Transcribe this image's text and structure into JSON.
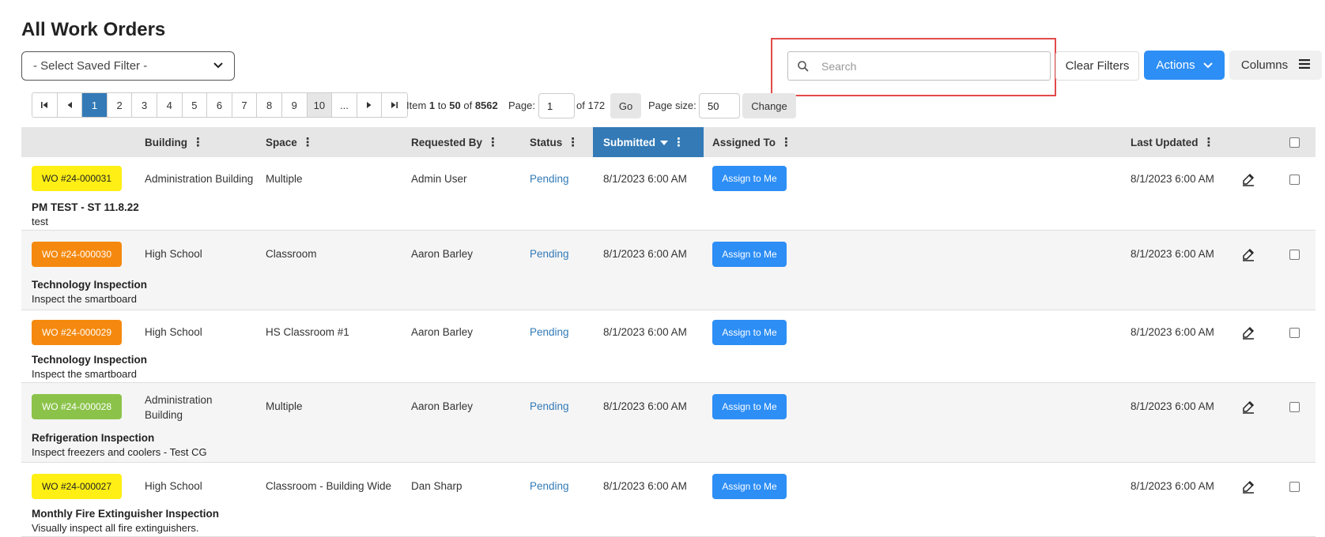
{
  "page": {
    "title": "All Work Orders"
  },
  "toolbar": {
    "saved_filter": "- Select Saved Filter -",
    "search_placeholder": "Search",
    "clear_filters": "Clear Filters",
    "actions": "Actions",
    "columns": "Columns"
  },
  "pagination": {
    "pages": [
      "1",
      "2",
      "3",
      "4",
      "5",
      "6",
      "7",
      "8",
      "9",
      "10",
      "..."
    ],
    "current_page": "1",
    "item_prefix": "Item",
    "item_from": "1",
    "item_to_word": "to",
    "item_to": "50",
    "item_of_word": "of",
    "item_total": "8562",
    "page_label": "Page:",
    "page_value": "1",
    "of_pages": "of 172",
    "go": "Go",
    "page_size_label": "Page size:",
    "page_size_value": "50",
    "change": "Change"
  },
  "table": {
    "columns": {
      "building": "Building",
      "space": "Space",
      "requested_by": "Requested By",
      "status": "Status",
      "submitted": "Submitted",
      "assigned_to": "Assigned To",
      "last_updated": "Last Updated"
    },
    "assign_label": "Assign to Me",
    "rows": [
      {
        "wo": "WO #24-000031",
        "badge_color": "#ffef14",
        "building": "Administration Building",
        "space": "Multiple",
        "requested_by": "Admin User",
        "status": "Pending",
        "submitted": "8/1/2023 6:00 AM",
        "last_updated": "8/1/2023 6:00 AM",
        "title": "PM TEST - ST 11.8.22",
        "description": "test"
      },
      {
        "wo": "WO #24-000030",
        "badge_color": "#f5890f",
        "building": "High School",
        "space": "Classroom",
        "requested_by": "Aaron Barley",
        "status": "Pending",
        "submitted": "8/1/2023 6:00 AM",
        "last_updated": "8/1/2023 6:00 AM",
        "title": "Technology Inspection",
        "description": "Inspect the smartboard"
      },
      {
        "wo": "WO #24-000029",
        "badge_color": "#f5890f",
        "building": "High School",
        "space": "HS Classroom #1",
        "requested_by": "Aaron Barley",
        "status": "Pending",
        "submitted": "8/1/2023 6:00 AM",
        "last_updated": "8/1/2023 6:00 AM",
        "title": "Technology Inspection",
        "description": "Inspect the smartboard"
      },
      {
        "wo": "WO #24-000028",
        "badge_color": "#8bc34a",
        "building": "Administration Building",
        "space": "Multiple",
        "requested_by": "Aaron Barley",
        "status": "Pending",
        "submitted": "8/1/2023 6:00 AM",
        "last_updated": "8/1/2023 6:00 AM",
        "title": "Refrigeration Inspection",
        "description": "Inspect freezers and coolers - Test CG"
      },
      {
        "wo": "WO #24-000027",
        "badge_color": "#ffef14",
        "building": "High School",
        "space": "Classroom - Building Wide",
        "requested_by": "Dan Sharp",
        "status": "Pending",
        "submitted": "8/1/2023 6:00 AM",
        "last_updated": "8/1/2023 6:00 AM",
        "title": "Monthly Fire Extinguisher Inspection",
        "description": "Visually inspect all fire extinguishers."
      }
    ]
  },
  "colors": {
    "primary": "#2d8ef5",
    "sorted_header": "#337ab7",
    "highlight": "#e34a4a"
  }
}
